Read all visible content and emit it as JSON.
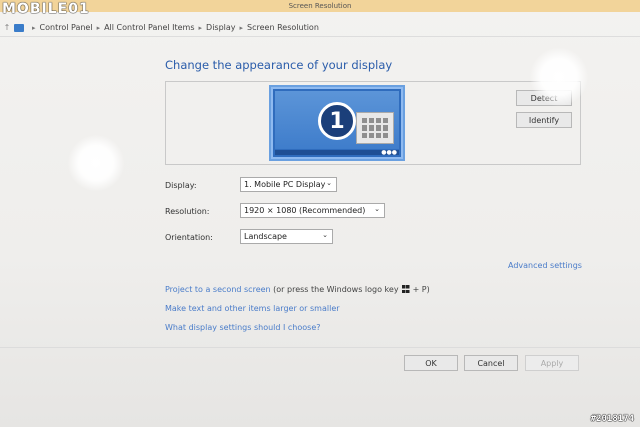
{
  "window": {
    "title": "Screen Resolution"
  },
  "watermark": {
    "logo": "MOBILE01",
    "photo_id": "#2018174"
  },
  "breadcrumb": {
    "up_icon": "up-arrow-icon",
    "items": [
      "Control Panel",
      "All Control Panel Items",
      "Display",
      "Screen Resolution"
    ],
    "separator": "▸"
  },
  "page": {
    "heading": "Change the appearance of your display",
    "monitor_number": "1",
    "detect_label": "Detect",
    "identify_label": "Identify"
  },
  "form": {
    "display_label": "Display:",
    "display_value": "1. Mobile PC Display",
    "resolution_label": "Resolution:",
    "resolution_value": "1920 × 1080 (Recommended)",
    "orientation_label": "Orientation:",
    "orientation_value": "Landscape"
  },
  "links": {
    "advanced": "Advanced settings",
    "project": "Project to a second screen",
    "project_hint_pre": "(or press the Windows logo key",
    "project_hint_post": "+ P)",
    "text_size": "Make text and other items larger or smaller",
    "which_settings": "What display settings should I choose?"
  },
  "buttons": {
    "ok": "OK",
    "cancel": "Cancel",
    "apply": "Apply"
  },
  "colors": {
    "accent": "#2a5caa",
    "link": "#4a7cc9",
    "title_bar": "#f2d49a"
  }
}
